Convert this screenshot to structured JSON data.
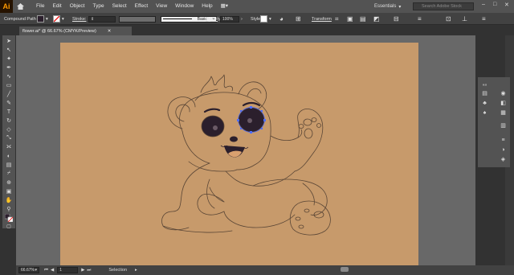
{
  "menubar": {
    "logo": "Ai",
    "items": [
      "File",
      "Edit",
      "Object",
      "Type",
      "Select",
      "Effect",
      "View",
      "Window",
      "Help"
    ],
    "workspace": "Essentials",
    "search_placeholder": "Search Adobe Stock"
  },
  "control": {
    "selection_type": "Compound Path",
    "stroke_label": "Stroke:",
    "stroke_style": "Basic",
    "opacity_label": "Opacity:",
    "opacity_value": "100%",
    "style_label": "Style:",
    "transform_label": "Transform"
  },
  "document": {
    "tab_label": "flower.ai* @ 66.67% (CMYK/Preview)"
  },
  "status": {
    "zoom": "66.67%",
    "artboard_number": "1",
    "tool_name": "Selection"
  },
  "colors": {
    "artboard": "#c79a6b",
    "accent": "#ff9a00",
    "outline": "#5a4636",
    "eye": "#2b1f2c"
  }
}
